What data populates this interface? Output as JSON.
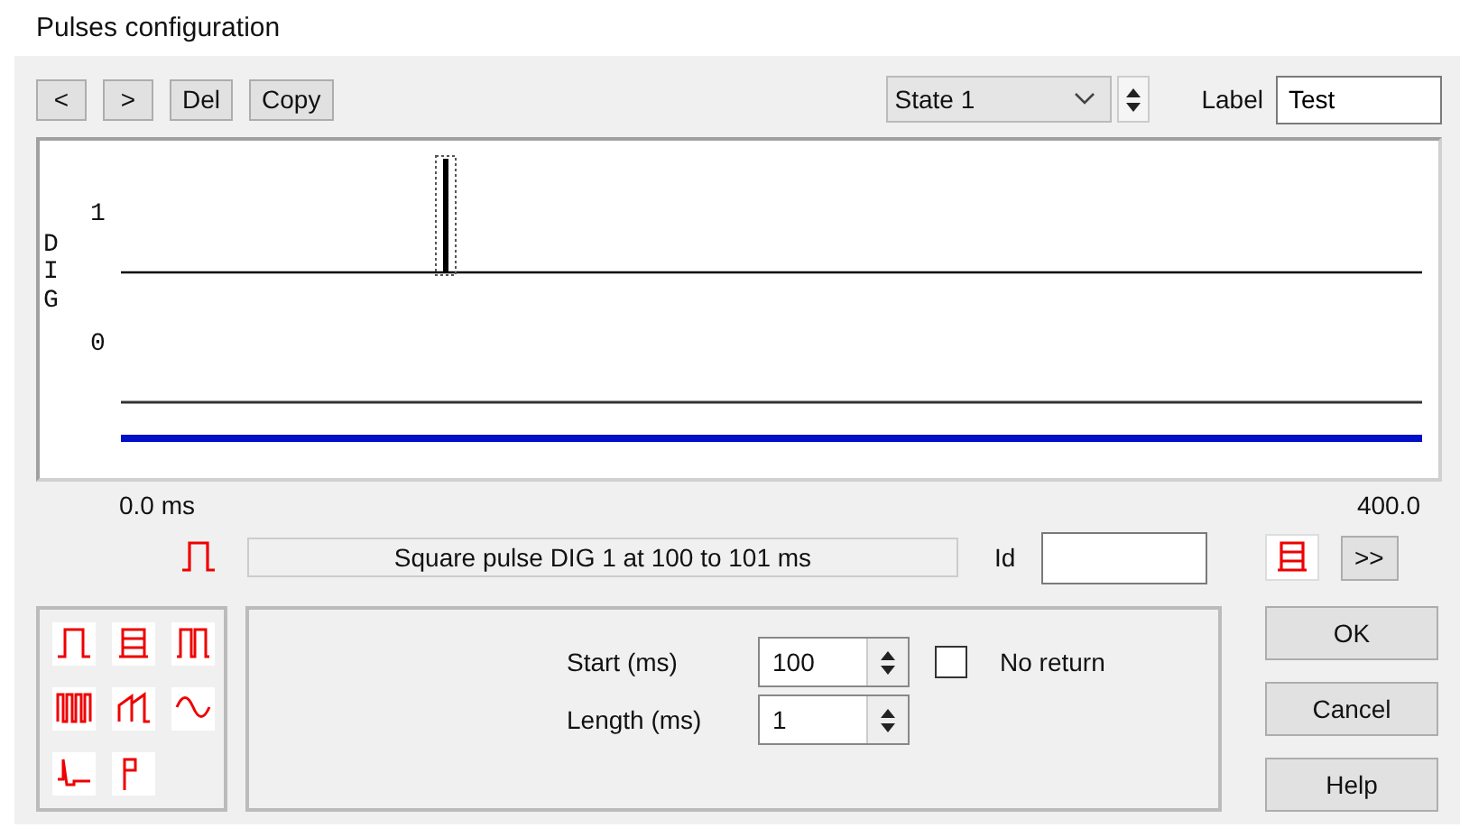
{
  "window": {
    "title": "Pulses configuration"
  },
  "toolbar": {
    "buttons": [
      "<",
      ">",
      "Del",
      "Copy"
    ],
    "state": {
      "value": "State 1"
    },
    "label": {
      "label": "Label",
      "value": "Test"
    }
  },
  "plot": {
    "channel": "DIG",
    "y_labels": [
      "1",
      "0"
    ],
    "x_start": "0.0 ms",
    "x_end": "400.0"
  },
  "pulse_row": {
    "icon": {
      "kind": "square"
    },
    "description": "Square pulse DIG 1 at 100 to 101 ms",
    "id": {
      "label": "Id"
    },
    "type_button": {
      "kind": "train"
    },
    "more_button": ">>"
  },
  "palette": [
    {
      "kind": "square"
    },
    {
      "kind": "train"
    },
    {
      "kind": "double"
    },
    {
      "kind": "multi"
    },
    {
      "kind": "ramp"
    },
    {
      "kind": "sine"
    },
    {
      "kind": "spike"
    },
    {
      "kind": "flag"
    }
  ],
  "params": {
    "start": {
      "label": "Start (ms)",
      "value": "100"
    },
    "length": {
      "label": "Length (ms)",
      "value": "1"
    },
    "no_return": {
      "label": "No return",
      "checked": false
    }
  },
  "buttons": [
    "OK",
    "Cancel",
    "Help"
  ]
}
